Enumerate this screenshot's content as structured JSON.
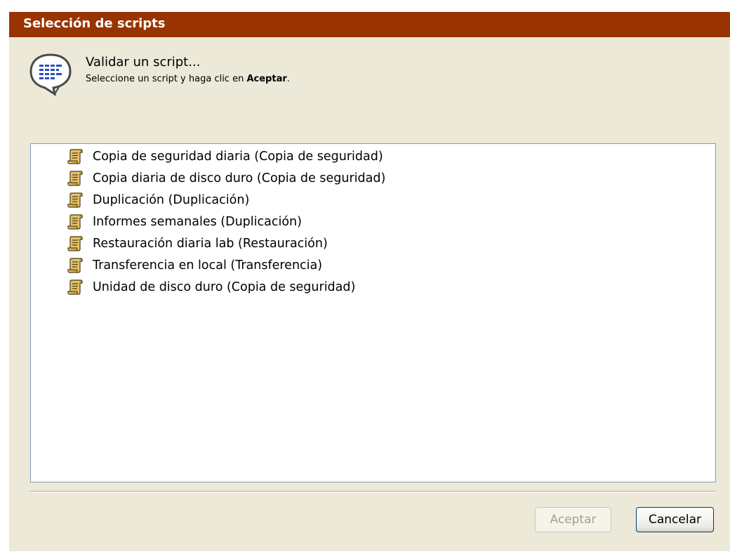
{
  "dialog": {
    "title": "Selección de scripts",
    "heading": "Validar un script...",
    "instruction_prefix": "Seleccione un script y haga clic en ",
    "instruction_bold": "Aceptar",
    "instruction_suffix": "."
  },
  "scripts": [
    {
      "label": "Copia de seguridad diaria (Copia de seguridad)",
      "icon": "script-scroll-icon"
    },
    {
      "label": "Copia diaria de disco duro (Copia de seguridad)",
      "icon": "script-scroll-icon"
    },
    {
      "label": "Duplicación (Duplicación)",
      "icon": "script-scroll-icon"
    },
    {
      "label": "Informes semanales (Duplicación)",
      "icon": "script-scroll-icon"
    },
    {
      "label": "Restauración diaria lab  (Restauración)",
      "icon": "script-scroll-icon"
    },
    {
      "label": "Transferencia en local (Transferencia)",
      "icon": "script-scroll-icon"
    },
    {
      "label": "Unidad de disco duro (Copia de seguridad)",
      "icon": "script-scroll-icon"
    }
  ],
  "buttons": {
    "ok_label": "Aceptar",
    "ok_enabled": false,
    "cancel_label": "Cancelar"
  },
  "colors": {
    "titlebar": "#993300",
    "dialog_bg": "#ece9d8",
    "list_border": "#7f9db9"
  }
}
